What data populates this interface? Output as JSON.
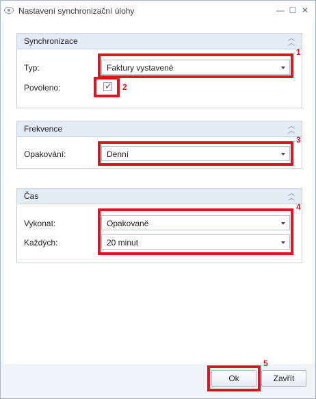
{
  "window": {
    "title": "Nastavení synchronizační úlohy",
    "minimize_glyph": "—",
    "maximize_glyph": "☐",
    "close_glyph": "✕"
  },
  "groups": {
    "sync": {
      "title": "Synchronizace",
      "type_label": "Typ:",
      "type_value": "Faktury vystavené",
      "enabled_label": "Povoleno:",
      "enabled_checked": true
    },
    "frequency": {
      "title": "Frekvence",
      "repeat_label": "Opakování:",
      "repeat_value": "Denní"
    },
    "time": {
      "title": "Čas",
      "execute_label": "Vykonat:",
      "execute_value": "Opakovaně",
      "every_label": "Každých:",
      "every_value": "20 minut"
    }
  },
  "annotations": [
    "1",
    "2",
    "3",
    "4",
    "5"
  ],
  "buttons": {
    "ok": "Ok",
    "close": "Zavřít"
  },
  "colors": {
    "highlight": "#e8101e",
    "group_header": "#e3ebf4",
    "border": "#c5cfdb"
  },
  "icons": {
    "app": "eye-icon",
    "collapse": "chevron-double-up-icon",
    "dropdown": "dropdown-arrow-icon",
    "check": "checkmark-icon"
  }
}
